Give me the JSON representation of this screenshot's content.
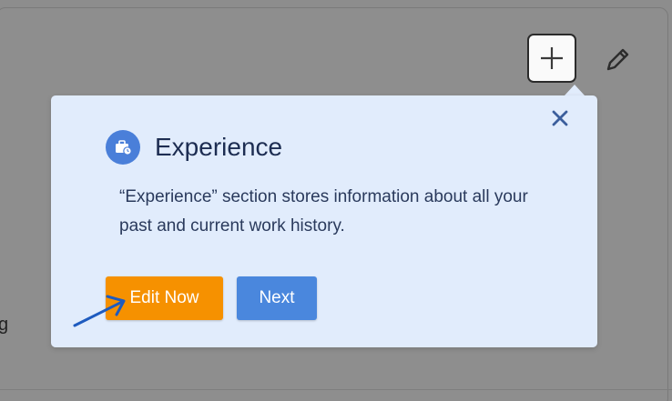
{
  "background": {
    "stray_text": "g"
  },
  "toolbar": {
    "add_icon": "plus-icon",
    "edit_icon": "pencil-icon"
  },
  "popover": {
    "title": "Experience",
    "icon": "briefcase-clock-icon",
    "description": "“Experience” section stores information about all your past and current work history.",
    "close_icon": "close-icon",
    "edit_now_label": "Edit Now",
    "next_label": "Next"
  },
  "colors": {
    "popover_bg": "#e1ecfc",
    "primary": "#f69100",
    "secondary": "#4a87dd",
    "overlay": "#8d8d8d",
    "arrow": "#1e5bbf"
  }
}
